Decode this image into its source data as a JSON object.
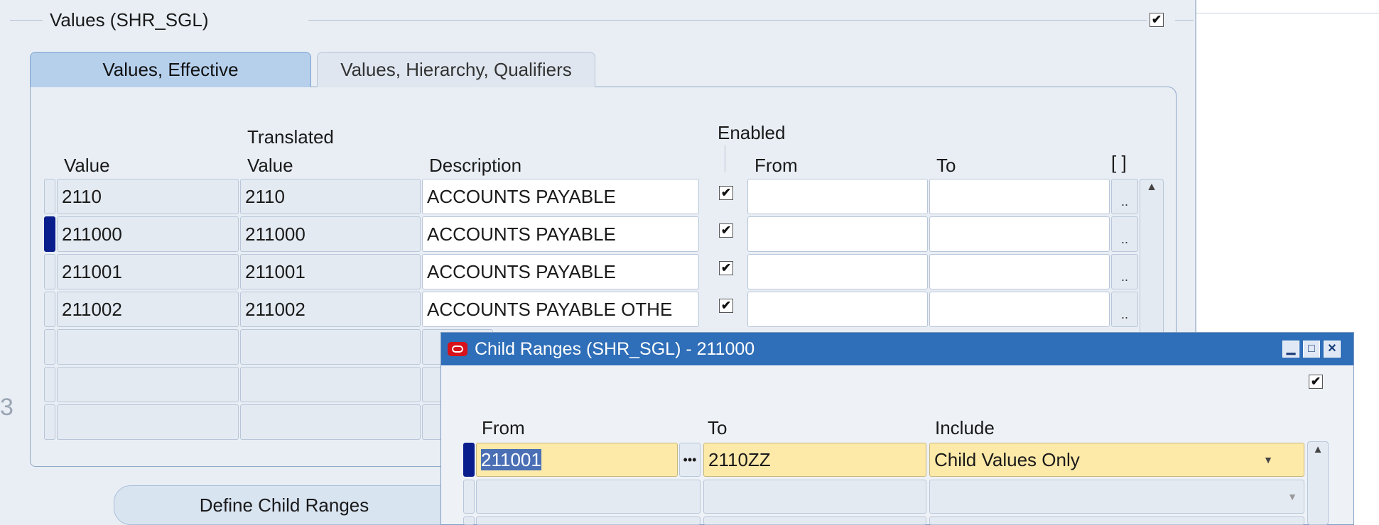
{
  "values_section": {
    "legend": "Values (SHR_SGL)",
    "checked": true,
    "tabs": [
      {
        "label": "Values, Effective",
        "active": true
      },
      {
        "label": "Values, Hierarchy, Qualifiers",
        "active": false
      }
    ],
    "headers": {
      "value": "Value",
      "translated_line1": "Translated",
      "translated_line2": "Value",
      "description": "Description",
      "enabled": "Enabled",
      "from": "From",
      "to": "To",
      "brackets": "[ ]"
    },
    "rows": [
      {
        "value": "2110",
        "translated": "2110",
        "description": "ACCOUNTS PAYABLE",
        "enabled": true
      },
      {
        "value": "211000",
        "translated": "211000",
        "description": "ACCOUNTS PAYABLE",
        "enabled": true
      },
      {
        "value": "211001",
        "translated": "211001",
        "description": "ACCOUNTS PAYABLE",
        "enabled": true
      },
      {
        "value": "211002",
        "translated": "211002",
        "description": "ACCOUNTS PAYABLE OTHE",
        "enabled": true
      }
    ],
    "define_child_ranges_button": "Define Child Ranges",
    "left_edge_glyph": "3"
  },
  "child_ranges_window": {
    "title": "Child Ranges (SHR_SGL) - 211000",
    "checked": true,
    "headers": {
      "from": "From",
      "to": "To",
      "include": "Include"
    },
    "rows": [
      {
        "from": "211001",
        "to": "2110ZZ",
        "include": "Child Values Only"
      }
    ]
  },
  "colors": {
    "titlebar": "#2f6eb8",
    "active_tab": "#b6d0ec",
    "current_row": "#fde9a8",
    "row_marker": "#0a1d8c"
  }
}
